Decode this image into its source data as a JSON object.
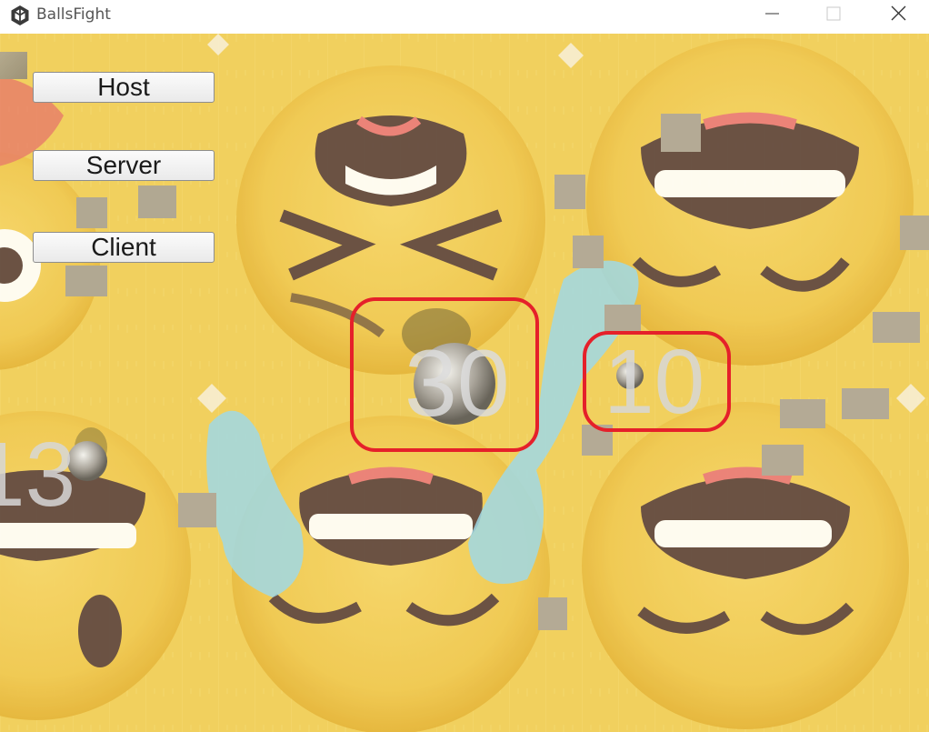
{
  "window": {
    "title": "BallsFight",
    "controls": {
      "minimize": "minimize-icon",
      "maximize": "maximize-icon",
      "close": "close-icon"
    }
  },
  "menu": {
    "host_label": "Host",
    "server_label": "Server",
    "client_label": "Client"
  },
  "scores": {
    "center_ball": "30",
    "right_ball": "10",
    "left_ball": "13"
  },
  "colors": {
    "background_yellow": "#f1cc4a",
    "highlight_red": "#e5202a",
    "water_blue": "#8fd3ea"
  }
}
